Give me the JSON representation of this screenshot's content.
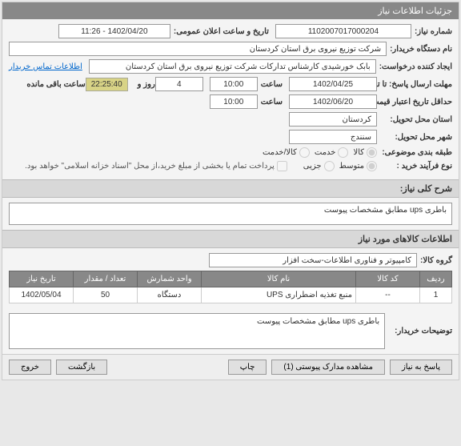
{
  "panel_title": "جزئیات اطلاعات نیاز",
  "rows": {
    "need_number_label": "شماره نیاز:",
    "need_number": "1102007017000204",
    "announce_label": "تاریخ و ساعت اعلان عمومی:",
    "announce_value": "1402/04/20 - 11:26",
    "buyer_org_label": "نام دستگاه خریدار:",
    "buyer_org": "شرکت توزیع نیروی برق استان کردستان",
    "requester_label": "ایجاد کننده درخواست:",
    "requester": "بابک خورشیدی کارشناس تدارکات شرکت توزیع نیروی برق استان کردستان",
    "contact_link": "اطلاعات تماس خریدار",
    "deadline_label": "مهلت ارسال پاسخ: تا تاریخ:",
    "deadline_date": "1402/04/25",
    "time_label": "ساعت",
    "deadline_time": "10:00",
    "day_label": "روز و",
    "day_value": "4",
    "remaining_time": "22:25:40",
    "remaining_label": "ساعت باقی مانده",
    "validity_label": "حداقل تاریخ اعتبار قیمت: تا تاریخ:",
    "validity_date": "1402/06/20",
    "validity_time": "10:00",
    "province_label": "استان محل تحویل:",
    "province": "کردستان",
    "city_label": "شهر محل تحویل:",
    "city": "سنندج",
    "category_label": "طبقه بندی موضوعی:",
    "cat_goods": "کالا",
    "cat_service": "خدمت",
    "cat_both": "کالا/خدمت",
    "process_label": "نوع فرآیند خرید :",
    "proc_mid": "متوسط",
    "proc_part": "جزیی",
    "pay_note_check": "پرداخت تمام یا بخشی از مبلغ خرید،از محل \"اسناد خزانه اسلامی\" خواهد بود."
  },
  "sections": {
    "desc_header": "شرح کلی نیاز:",
    "desc_text": "باطری ups مطابق مشخصات پیوست",
    "goods_header": "اطلاعات کالاهای مورد نیاز",
    "group_label": "گروه کالا:",
    "group_value": "کامپیوتر و فناوری اطلاعات-سخت افزار",
    "buyer_notes_label": "توضیحات خریدار:",
    "buyer_notes": "باطری ups مطابق مشخصات پیوست"
  },
  "table": {
    "headers": [
      "ردیف",
      "کد کالا",
      "نام کالا",
      "واحد شمارش",
      "تعداد / مقدار",
      "تاریخ نیاز"
    ],
    "row": {
      "idx": "1",
      "code": "--",
      "name": "منبع تغذیه اضطراری UPS",
      "unit": "دستگاه",
      "qty": "50",
      "date": "1402/05/04"
    }
  },
  "footer": {
    "respond": "پاسخ به نیاز",
    "attachments": "مشاهده مدارک پیوستی (1)",
    "print": "چاپ",
    "back": "بازگشت",
    "exit": "خروج"
  }
}
